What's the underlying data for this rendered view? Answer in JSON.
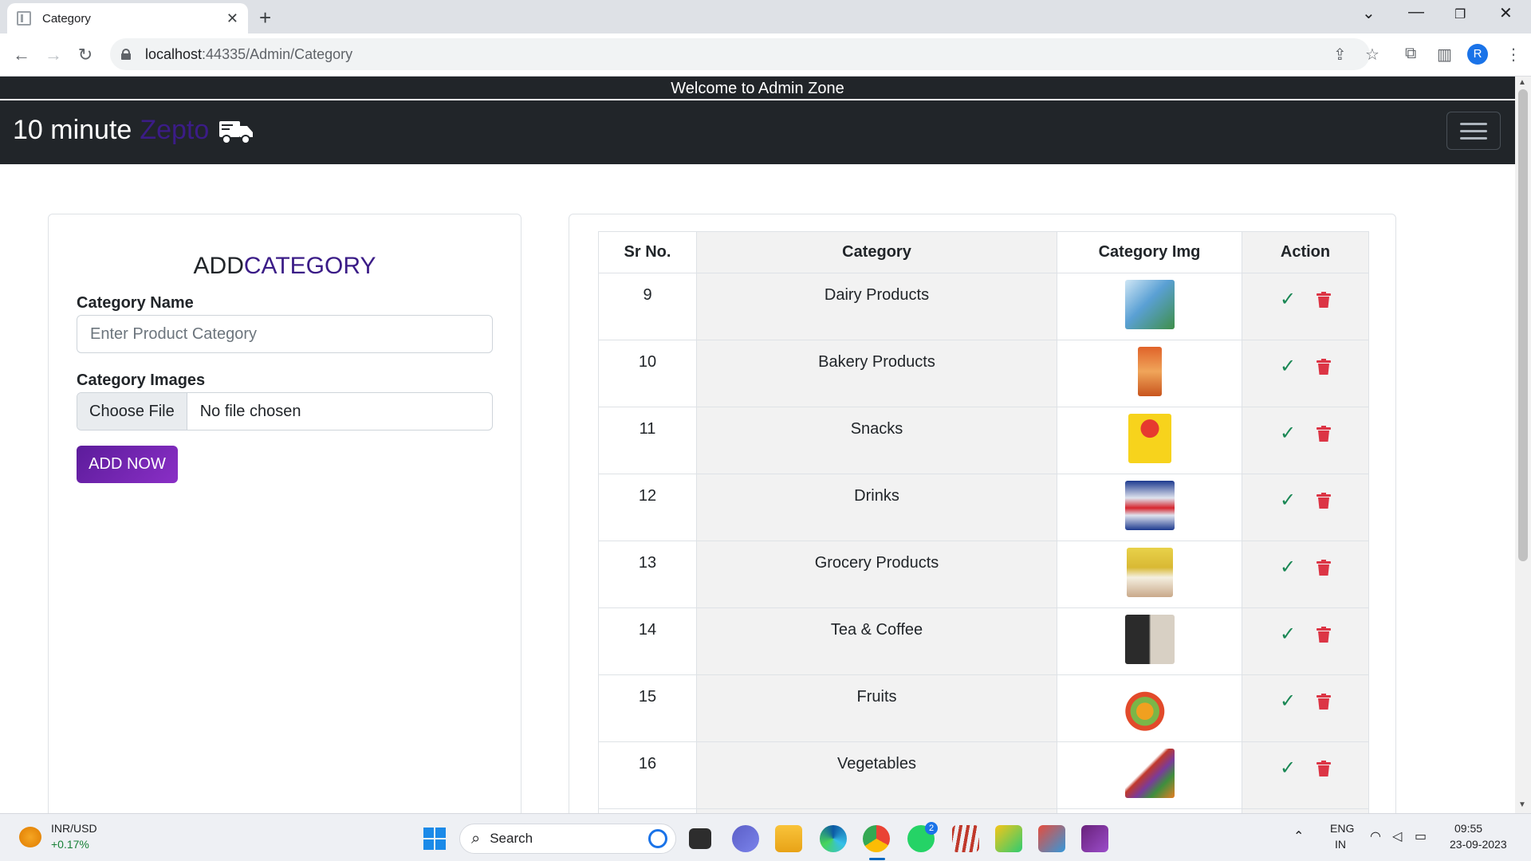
{
  "browser": {
    "tab_title": "Category",
    "url_host": "localhost",
    "url_rest": ":44335/Admin/Category"
  },
  "page": {
    "welcome": "Welcome to Admin Zone",
    "brand_main": "10 minute",
    "brand_accent": "Zepto",
    "form": {
      "title_main": "ADD",
      "title_accent": "CATEGORY",
      "name_label": "Category Name",
      "name_placeholder": "Enter Product Category",
      "images_label": "Category Images",
      "file_button": "Choose File",
      "file_status": "No file chosen",
      "submit": "ADD NOW"
    },
    "table": {
      "headers": [
        "Sr No.",
        "Category",
        "Category Img",
        "Action"
      ],
      "rows": [
        {
          "sr": "9",
          "category": "Dairy Products"
        },
        {
          "sr": "10",
          "category": "Bakery Products"
        },
        {
          "sr": "11",
          "category": "Snacks"
        },
        {
          "sr": "12",
          "category": "Drinks"
        },
        {
          "sr": "13",
          "category": "Grocery Products"
        },
        {
          "sr": "14",
          "category": "Tea & Coffee"
        },
        {
          "sr": "15",
          "category": "Fruits"
        },
        {
          "sr": "16",
          "category": "Vegetables"
        }
      ]
    }
  },
  "taskbar": {
    "widget_title": "INR/USD",
    "widget_value": "+0.17%",
    "search": "Search",
    "whatsapp_badge": "2",
    "lang_top": "ENG",
    "lang_bottom": "IN",
    "time": "09:55",
    "date": "23-09-2023"
  },
  "colors": {
    "accent": "#3b1c87",
    "success": "#198754",
    "danger": "#dc3545",
    "navbar": "#212529"
  }
}
